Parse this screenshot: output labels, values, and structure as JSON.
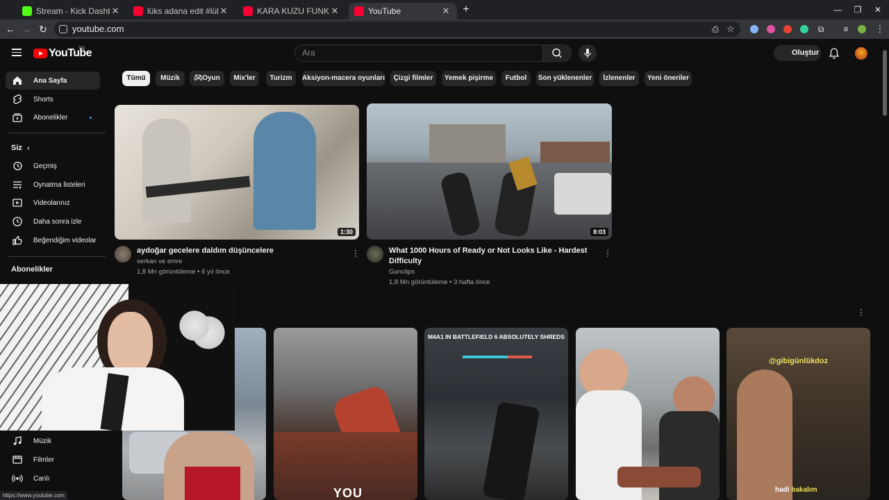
{
  "browser": {
    "tabs": [
      {
        "title": "Stream - Kick Dashboard",
        "active": false
      },
      {
        "title": "lüks adana edit #lüksadana #lü",
        "active": false
      },
      {
        "title": "KARA KUZU FUNK - YouTube",
        "active": false
      },
      {
        "title": "YouTube",
        "active": true
      }
    ],
    "new_tab": "+",
    "close": "✕",
    "address": "youtube.com",
    "status_url": "https://www.youtube.com"
  },
  "header": {
    "logo_text": "YouTube",
    "country": "TR",
    "search_placeholder": "Ara",
    "create_label": "Oluştur"
  },
  "sidebar": {
    "main": [
      {
        "label": "Ana Sayfa",
        "icon": "home-icon",
        "active": true
      },
      {
        "label": "Shorts",
        "icon": "shorts-icon"
      },
      {
        "label": "Abonelikler",
        "icon": "subscriptions-icon"
      }
    ],
    "you_heading": "Siz",
    "you_items": [
      {
        "label": "Geçmiş",
        "icon": "history-icon"
      },
      {
        "label": "Oynatma listeleri",
        "icon": "playlists-icon"
      },
      {
        "label": "Videolarınız",
        "icon": "your-videos-icon"
      },
      {
        "label": "Daha sonra izle",
        "icon": "watch-later-icon"
      },
      {
        "label": "Beğendiğim videolar",
        "icon": "liked-icon"
      }
    ],
    "subs_heading": "Abonelikler",
    "explore_items": [
      {
        "label": "Müzik",
        "icon": "music-icon"
      },
      {
        "label": "Filmler",
        "icon": "movies-icon"
      },
      {
        "label": "Canlı",
        "icon": "live-icon"
      }
    ]
  },
  "chips": [
    "Tümü",
    "Müzik",
    "Oyun",
    "Mix'ler",
    "Turizm",
    "Aksiyon-macera oyunları",
    "Çizgi filmler",
    "Yemek pişirme",
    "Futbol",
    "Son yüklenenler",
    "İzlenenler",
    "Yeni öneriler"
  ],
  "videos": [
    {
      "title": "aydoğar gecelere daldım düşüncelere",
      "channel": "serkan ve emre",
      "stats": "1,8 Mn görüntüleme • 6 yıl önce",
      "duration": "1:30"
    },
    {
      "title_line1": "What 1000 Hours of Ready or Not Looks Like - Hardest",
      "title_line2": "Difficulty",
      "channel": "Gunclips",
      "stats": "1,8 Mn görüntüleme • 3 hafta önce",
      "duration": "8:03"
    }
  ],
  "shorts": [
    {
      "overlay": ""
    },
    {
      "overlay": "YOU"
    },
    {
      "overlay": "M4A1 IN BATTLEFIELD 6 ABSOLUTELY SHREDS"
    },
    {
      "overlay": ""
    },
    {
      "overlay_top": "@gibigünlükdoz",
      "overlay_bottom_1": "hadi",
      "overlay_bottom_2": "bakalım"
    }
  ],
  "colors": {
    "brand_red": "#ff0000",
    "background": "#0f0f0f",
    "chip_bg": "#272727",
    "accent_blue": "#3ea6ff"
  }
}
